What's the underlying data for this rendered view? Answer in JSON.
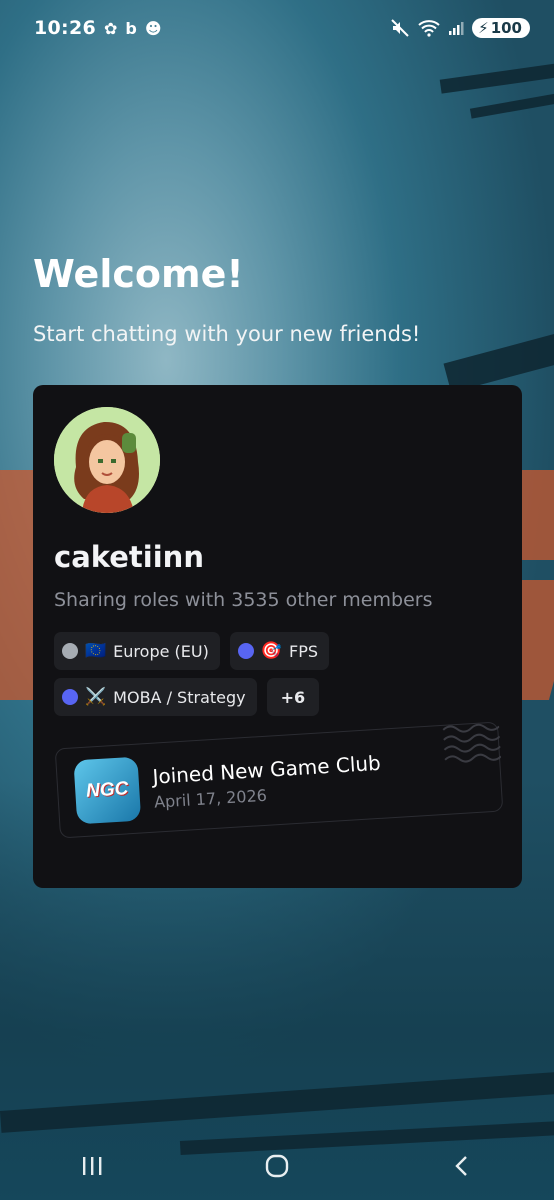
{
  "status_bar": {
    "time": "10:26",
    "notif_icons": [
      "brain-icon",
      "bing-icon",
      "snapchat-icon"
    ],
    "battery": "100"
  },
  "welcome": {
    "title": "Welcome!",
    "subtitle": "Start chatting with your new friends!"
  },
  "profile": {
    "username": "caketiinn",
    "shared_roles": "Sharing roles with 3535 other members",
    "roles": [
      {
        "label": "Europe (EU)",
        "emoji": "🇪🇺",
        "dot_color": "#a6acb3"
      },
      {
        "label": "FPS",
        "emoji": "🎯",
        "dot_color": "#5865f2"
      },
      {
        "label": "MOBA / Strategy",
        "emoji": "⚔️",
        "dot_color": "#5865f2"
      }
    ],
    "more_roles": "+6"
  },
  "server_join": {
    "title": "Joined New Game Club",
    "date": "April 17, 2026",
    "icon_text": "NGC"
  },
  "colors": {
    "card_bg": "#111114",
    "chip_bg": "#1f2024",
    "muted_text": "#8d9099"
  }
}
